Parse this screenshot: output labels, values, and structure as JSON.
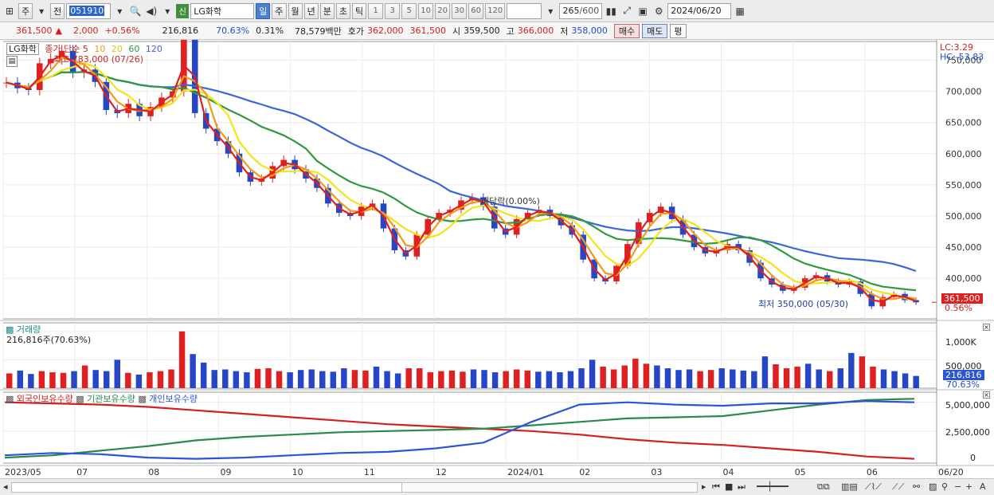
{
  "toolbar": {
    "tabs": [
      "주",
      "전"
    ],
    "code": "051910",
    "badge": "신",
    "name": "LG화학",
    "periods": [
      "일",
      "주",
      "월",
      "년",
      "분",
      "초",
      "틱"
    ],
    "active_period": "일",
    "ranges": [
      "1",
      "3",
      "5",
      "10",
      "20",
      "30",
      "60",
      "120"
    ],
    "count": "265",
    "count_total": "/600",
    "date": "2024/06/20"
  },
  "quote": {
    "price": "361,500",
    "arrow": "▲",
    "change": "2,000",
    "change_pct": "+0.56%",
    "volume": "216,816",
    "vol_ratio": "70.63%",
    "turnover": "0.31%",
    "amount": "78,579백만",
    "hoga_label": "호가",
    "ask": "362,000",
    "bid": "361,500",
    "open_label": "시",
    "open": "359,500",
    "high_label": "고",
    "high": "366,000",
    "low_label": "저",
    "low": "358,000",
    "buy_label": "매수",
    "sell_label": "매도",
    "eval_label": "평"
  },
  "main_legend": {
    "name": "LG화학",
    "ma_title": "종가 단순 5",
    "ma10": "10",
    "ma20": "20",
    "ma60": "60",
    "ma120": "120",
    "max_note": "최고 783,000 (07/26)",
    "min_note": "최저 350,000 (05/30)",
    "div_note": "배당락(0.00%)",
    "lc": "LC:3.29",
    "hc": "HC:-53.83",
    "last_price": "361,500",
    "last_pct": "0.56%"
  },
  "volume_panel": {
    "title": "거래량",
    "value": "216,816주(70.63%)",
    "last": "216,816",
    "last_pct": "70.63%",
    "ticks": [
      "1,000K",
      "500,000"
    ]
  },
  "holding_panel": {
    "foreign": "외국인보유수량",
    "institution": "기관보유수량",
    "individual": "개인보유수량",
    "ticks": [
      "5,000,000",
      "2,500,000",
      "0"
    ]
  },
  "chart_data": {
    "type": "line",
    "title": "LG화학",
    "x_labels": [
      "2023/05",
      "07",
      "08",
      "09",
      "10",
      "11",
      "12",
      "2024/01",
      "02",
      "03",
      "04",
      "05",
      "06",
      "06/20"
    ],
    "y_ticks": [
      "750,000",
      "700,000",
      "650,000",
      "600,000",
      "550,000",
      "500,000",
      "450,000",
      "400,000"
    ],
    "ylim": [
      335000,
      780000
    ],
    "close_series": [
      714000,
      705000,
      702000,
      745000,
      752000,
      765000,
      730000,
      735000,
      715000,
      670000,
      665000,
      680000,
      660000,
      675000,
      690000,
      700000,
      783000,
      665000,
      640000,
      620000,
      600000,
      570000,
      555000,
      560000,
      580000,
      590000,
      575000,
      560000,
      545000,
      520000,
      505000,
      500000,
      515000,
      520000,
      480000,
      445000,
      435000,
      470000,
      495000,
      505000,
      510000,
      525000,
      530000,
      515000,
      480000,
      470000,
      495000,
      505000,
      510000,
      500000,
      485000,
      470000,
      430000,
      400000,
      395000,
      420000,
      455000,
      490000,
      505000,
      515000,
      495000,
      470000,
      450000,
      440000,
      445000,
      455000,
      445000,
      425000,
      400000,
      390000,
      380000,
      385000,
      400000,
      405000,
      395000,
      390000,
      395000,
      375000,
      355000,
      370000,
      375000,
      365000,
      361500
    ],
    "ma": [
      {
        "name": "5",
        "color": "#e02020"
      },
      {
        "name": "10",
        "color": "#f29a1a"
      },
      {
        "name": "20",
        "color": "#f5e31a"
      },
      {
        "name": "60",
        "color": "#2e9a3e"
      },
      {
        "name": "120",
        "color": "#3a66d8"
      }
    ],
    "volume": [
      260,
      310,
      250,
      300,
      280,
      270,
      300,
      400,
      320,
      300,
      500,
      270,
      240,
      280,
      300,
      330,
      1000,
      600,
      450,
      320,
      330,
      300,
      280,
      340,
      350,
      300,
      280,
      320,
      330,
      300,
      290,
      350,
      320,
      310,
      380,
      300,
      260,
      350,
      350,
      280,
      300,
      310,
      290,
      330,
      320,
      280,
      300,
      330,
      310,
      290,
      300,
      280,
      300,
      350,
      500,
      380,
      330,
      400,
      520,
      430,
      400,
      350,
      320,
      330,
      300,
      320,
      350,
      330,
      310,
      300,
      560,
      420,
      350,
      380,
      430,
      330,
      300,
      350,
      620,
      560,
      380,
      330,
      300,
      260,
      216
    ],
    "holdings": [
      {
        "name": "외국인보유수량",
        "color": "#d42020",
        "values": [
          5000000,
          4900000,
          4800000,
          4600000,
          4300000,
          4000000,
          3700000,
          3400000,
          3100000,
          2900000,
          2700000,
          2500000,
          2200000,
          1800000,
          1500000,
          1300000,
          1000000,
          700000,
          300000,
          100000
        ]
      },
      {
        "name": "기관보유수량",
        "color": "#2a8a4e",
        "values": [
          200000,
          400000,
          800000,
          1200000,
          1700000,
          2000000,
          2200000,
          2400000,
          2500000,
          2600000,
          2700000,
          3000000,
          3300000,
          3600000,
          3700000,
          3800000,
          4300000,
          4800000,
          5200000,
          5300000
        ]
      },
      {
        "name": "개인보유수량",
        "color": "#2b55d8",
        "values": [
          400000,
          600000,
          500000,
          200000,
          100000,
          200000,
          400000,
          600000,
          700000,
          1000000,
          1500000,
          3300000,
          4800000,
          5000000,
          4800000,
          4700000,
          4900000,
          4900000,
          5100000,
          5000000
        ]
      }
    ]
  }
}
